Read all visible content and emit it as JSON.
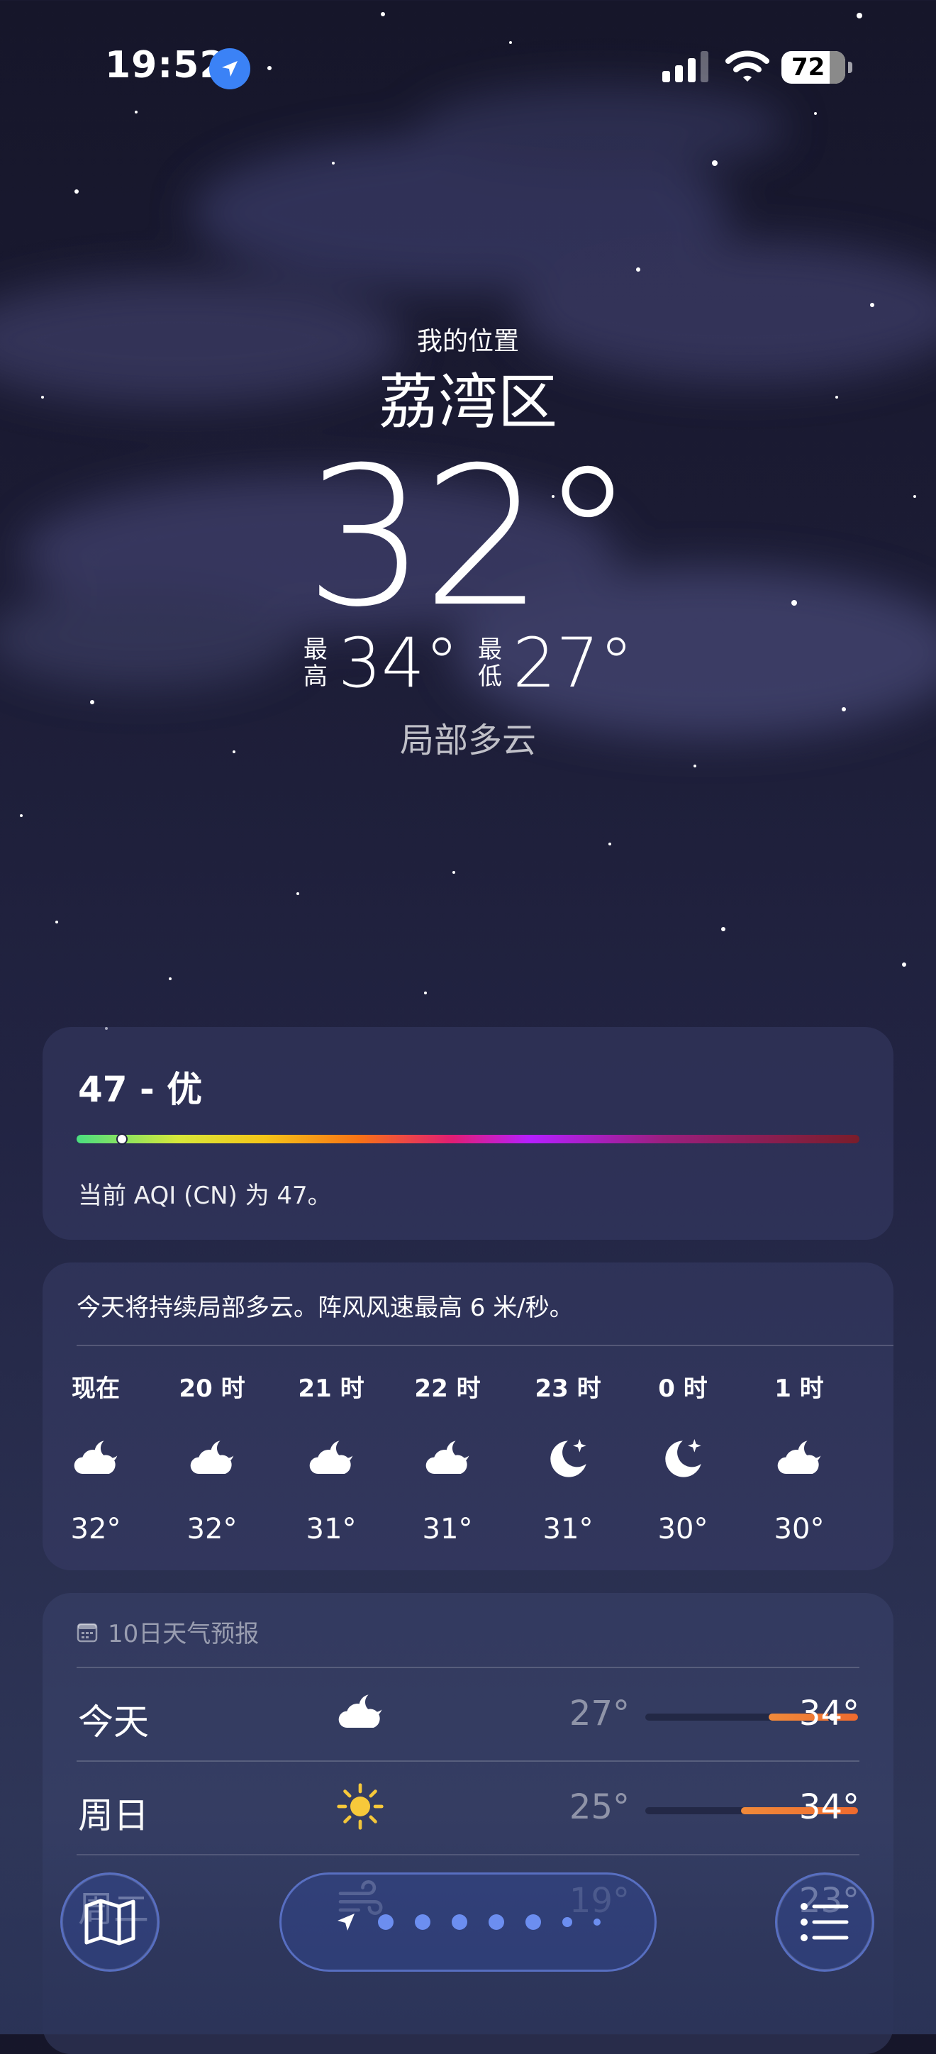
{
  "status_bar": {
    "time": "19:52",
    "battery": "72"
  },
  "hero": {
    "location_label": "我的位置",
    "city": "荔湾区",
    "temperature": "32°",
    "high_label": "最高",
    "high": "34°",
    "low_label": "最低",
    "low": "27°",
    "condition": "局部多云"
  },
  "aqi": {
    "title": "47 - 优",
    "description": "当前 AQI (CN) 为 47。",
    "value_fraction": 0.1
  },
  "hourly": {
    "summary": "今天将持续局部多云。阵风风速最高 6 米/秒。",
    "hours": [
      {
        "label": "现在",
        "icon": "partly-cloudy-night-icon",
        "temp": "32°"
      },
      {
        "label": "20 时",
        "icon": "partly-cloudy-night-icon",
        "temp": "32°"
      },
      {
        "label": "21 时",
        "icon": "partly-cloudy-night-icon",
        "temp": "31°"
      },
      {
        "label": "22 时",
        "icon": "partly-cloudy-night-icon",
        "temp": "31°"
      },
      {
        "label": "23 时",
        "icon": "clear-night-icon",
        "temp": "31°"
      },
      {
        "label": "0 时",
        "icon": "clear-night-icon",
        "temp": "30°"
      },
      {
        "label": "1 时",
        "icon": "partly-cloudy-night-icon",
        "temp": "30°"
      }
    ]
  },
  "ten_day": {
    "header": "10日天气预报",
    "days": [
      {
        "name": "今天",
        "icon": "partly-cloudy-night-icon",
        "low": "27°",
        "high": "34°",
        "range_start": 0.58,
        "range_end": 1.0,
        "current": 0.88
      },
      {
        "name": "周日",
        "icon": "sun-icon",
        "low": "25°",
        "high": "34°",
        "range_start": 0.45,
        "range_end": 1.0
      },
      {
        "name": "周二",
        "icon": "wind-icon",
        "low": "19°",
        "high": "23°"
      }
    ]
  },
  "colors": {
    "accent": "#3b82f6",
    "range": "#ef6a2e",
    "pager": "#6c8ef0"
  }
}
